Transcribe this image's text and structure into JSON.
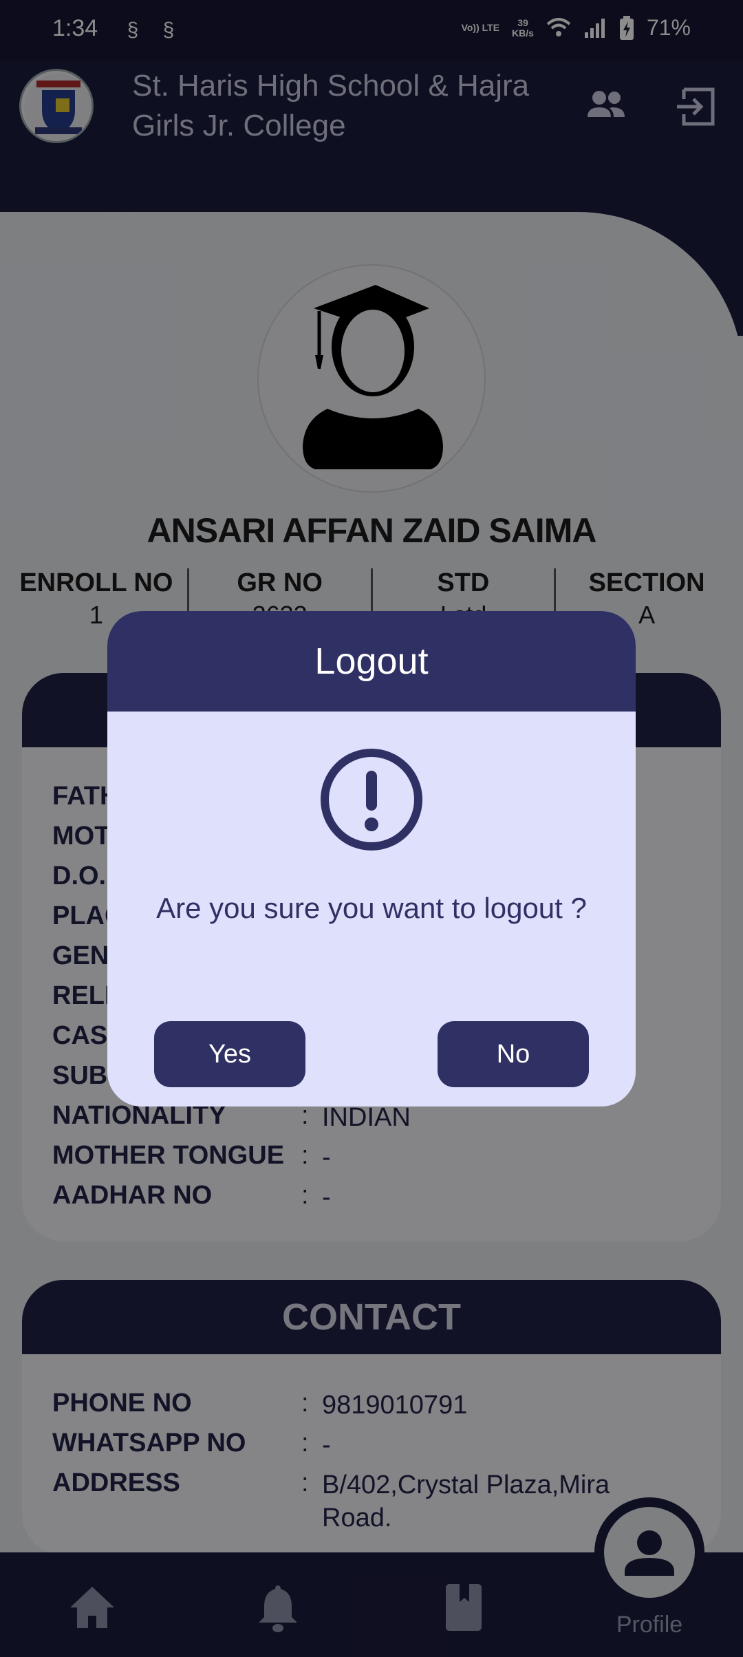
{
  "status_bar": {
    "time": "1:34",
    "notification_icons": [
      "sim-notification-icon",
      "sim-notification-icon"
    ],
    "volte": "Vo)) LTE",
    "speed_value": "39",
    "speed_unit": "KB/s",
    "battery": "71%"
  },
  "header": {
    "school_name": "St. Haris High School & Hajra Girls Jr. College"
  },
  "profile": {
    "name": "ANSARI AFFAN ZAID SAIMA",
    "info": [
      {
        "label": "ENROLL NO",
        "value": "1"
      },
      {
        "label": "GR NO",
        "value": "2633"
      },
      {
        "label": "STD",
        "value": "I std"
      },
      {
        "label": "SECTION",
        "value": "A"
      }
    ]
  },
  "personal": {
    "rows": [
      {
        "label": "FATH",
        "value": ""
      },
      {
        "label": "MOT",
        "value": ""
      },
      {
        "label": "D.O.",
        "value": ""
      },
      {
        "label": "PLAC",
        "value": ""
      },
      {
        "label": "GEN",
        "value": ""
      },
      {
        "label": "RELI",
        "value": ""
      },
      {
        "label": "CAS",
        "value": ""
      },
      {
        "label": "SUB",
        "value": ""
      },
      {
        "label": "NATIONALITY",
        "value": "INDIAN"
      },
      {
        "label": "MOTHER TONGUE",
        "value": "-"
      },
      {
        "label": "AADHAR NO",
        "value": "-"
      }
    ]
  },
  "contact": {
    "title": "CONTACT",
    "rows": [
      {
        "label": "PHONE NO",
        "value": "9819010791"
      },
      {
        "label": "WHATSAPP NO",
        "value": "-"
      },
      {
        "label": "ADDRESS",
        "value": "B/402,Crystal Plaza,Mira Road."
      }
    ]
  },
  "bottom_nav": {
    "profile_label": "Profile"
  },
  "dialog": {
    "title": "Logout",
    "message": "Are you sure you want to logout ?",
    "yes_label": "Yes",
    "no_label": "No"
  },
  "colors": {
    "primary": "#2f3063",
    "header": "#1b1c3d",
    "dialog_bg": "#dfe0fc"
  }
}
